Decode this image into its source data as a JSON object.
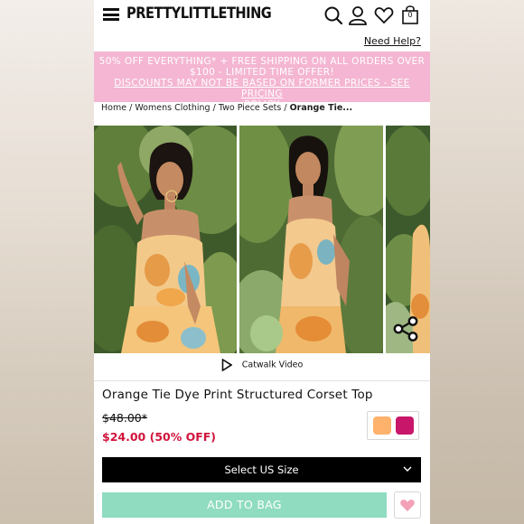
{
  "header": {
    "brand": "PRETTYLITTLETHING",
    "bag_count": "0",
    "icons": [
      "menu-icon",
      "search-icon",
      "account-icon",
      "heart-icon",
      "bag-icon"
    ]
  },
  "help_link": "Need Help?",
  "promo": {
    "line1": "50% OFF EVERYTHING* + FREE SHIPPING ON ALL ORDERS OVER",
    "line2": "$100 - LIMITED TIME OFFER!",
    "line3": "DISCOUNTS MAY NOT BE BASED ON FORMER PRICES - SEE PRICING",
    "line4": "POLICY",
    "bg_color": "#f4b6d2"
  },
  "breadcrumb": {
    "items": [
      "Home",
      "Womens Clothing",
      "Two Piece Sets"
    ],
    "current": "Orange Tie...",
    "separator": "/"
  },
  "gallery": {
    "catwalk_label": "Catwalk Video"
  },
  "product": {
    "title": "Orange Tie Dye Print Structured Corset Top",
    "old_price": "$48.00*",
    "new_price": "$24.00",
    "discount": "(50% OFF)",
    "swatch_colors": [
      "#ffb26b",
      "#c8176a"
    ]
  },
  "actions": {
    "size_label": "Select US Size",
    "add_to_bag": "ADD TO BAG",
    "add_color": "#8fdcc0"
  }
}
